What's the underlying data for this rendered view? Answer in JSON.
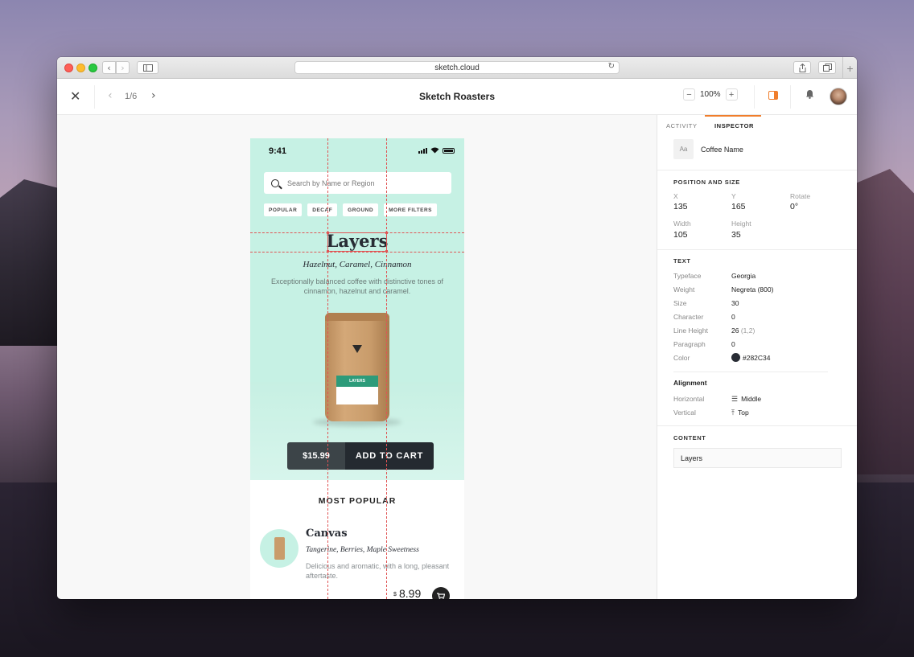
{
  "browser": {
    "url": "sketch.cloud",
    "reload_icon": "reload-icon",
    "new_tab_label": "+"
  },
  "appbar": {
    "page_counter": "1/6",
    "title": "Sketch Roasters",
    "zoom_value": "100%",
    "zoom_minus": "−",
    "zoom_plus": "+"
  },
  "phone": {
    "status_time": "9:41",
    "search_placeholder": "Search by Name or Region",
    "chips": [
      "POPULAR",
      "DECAF",
      "GROUND",
      "MORE FILTERS"
    ],
    "product": {
      "name": "Layers",
      "notes": "Hazelnut, Caramel, Cinnamon",
      "description": "Exceptionally balanced coffee with distinctive tones of cinnamon, hazelnut and caramel.",
      "bag_label": "LAYERS"
    },
    "cta": {
      "price": "$15.99",
      "action": "ADD TO CART"
    },
    "section_title": "MOST POPULAR",
    "list_item": {
      "name": "Canvas",
      "notes": "Tangerine, Berries, Maple Sweetness",
      "description": "Delicious and aromatic, with a long, pleasant aftertaste.",
      "currency": "$",
      "price": "8.99"
    }
  },
  "inspector": {
    "tabs": {
      "activity": "ACTIVITY",
      "inspector": "INSPECTOR"
    },
    "layer": {
      "icon_text": "Aa",
      "name": "Coffee Name"
    },
    "position_size": {
      "heading": "POSITION AND SIZE",
      "x_label": "X",
      "x": "135",
      "y_label": "Y",
      "y": "165",
      "rotate_label": "Rotate",
      "rotate": "0°",
      "width_label": "Width",
      "width": "105",
      "height_label": "Height",
      "height": "35"
    },
    "text": {
      "heading": "TEXT",
      "typeface_label": "Typeface",
      "typeface": "Georgia",
      "weight_label": "Weight",
      "weight": "Negreta (800)",
      "size_label": "Size",
      "size": "30",
      "character_label": "Character",
      "character": "0",
      "line_height_label": "Line Height",
      "line_height": "26",
      "line_height_ratio": "(1,2)",
      "paragraph_label": "Paragraph",
      "paragraph": "0",
      "color_label": "Color",
      "color": "#282C34"
    },
    "alignment": {
      "heading": "Alignment",
      "horizontal_label": "Horizontal",
      "horizontal": "Middle",
      "vertical_label": "Vertical",
      "vertical": "Top"
    },
    "content": {
      "heading": "CONTENT",
      "value": "Layers"
    }
  },
  "colors": {
    "accent": "#F07E2C",
    "hero": "#C6F1E4",
    "text_dark": "#282C34",
    "guide": "#E05454"
  }
}
